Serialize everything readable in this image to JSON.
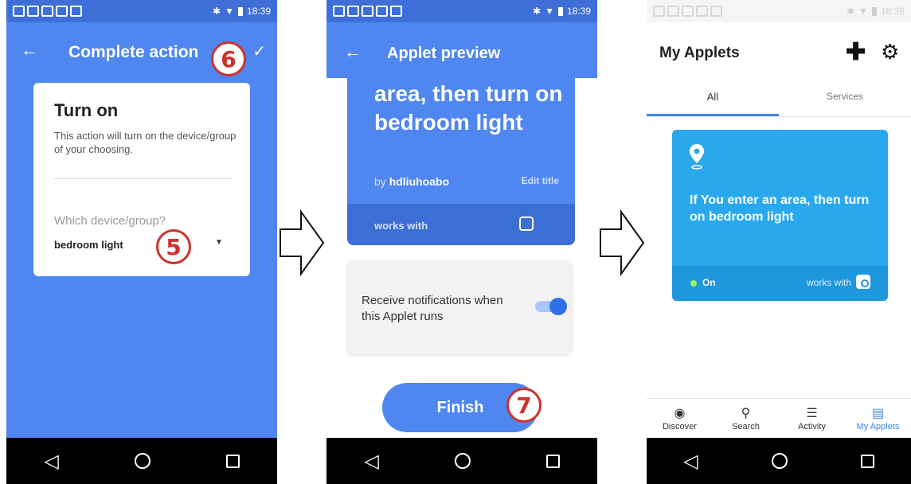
{
  "status_bar": {
    "time": "18:39"
  },
  "screen1": {
    "header_title": "Complete action",
    "card_title": "Turn on",
    "card_description": "This action will turn on the device/group of your choosing.",
    "device_question": "Which device/group?",
    "device_value": "bedroom light"
  },
  "screen2": {
    "header_title": "Applet preview",
    "applet_title": "area, then turn on bedroom light",
    "by_prefix": "by",
    "author": "hdliuhoabo",
    "edit_title": "Edit title",
    "works_with": "works with",
    "notifications_label": "Receive notifications when this Applet runs",
    "notifications_enabled": true,
    "finish_label": "Finish"
  },
  "screen3": {
    "header_title": "My Applets",
    "tabs": [
      {
        "label": "All",
        "selected": true
      },
      {
        "label": "Services",
        "selected": false
      }
    ],
    "applet_title": "If You enter an area, then turn on bedroom light",
    "applet_status": "On",
    "works_with": "works with",
    "bottom_nav": [
      {
        "label": "Discover",
        "icon": "eye-icon"
      },
      {
        "label": "Search",
        "icon": "search-icon"
      },
      {
        "label": "Activity",
        "icon": "list-icon"
      },
      {
        "label": "My Applets",
        "icon": "document-icon",
        "active": true
      }
    ]
  },
  "callouts": {
    "five": "5",
    "six": "6",
    "seven": "7"
  },
  "colors": {
    "ifttt_blue": "#4f86ef",
    "applet_card_blue": "#2aa8ee",
    "callout_red": "#d0312d"
  }
}
